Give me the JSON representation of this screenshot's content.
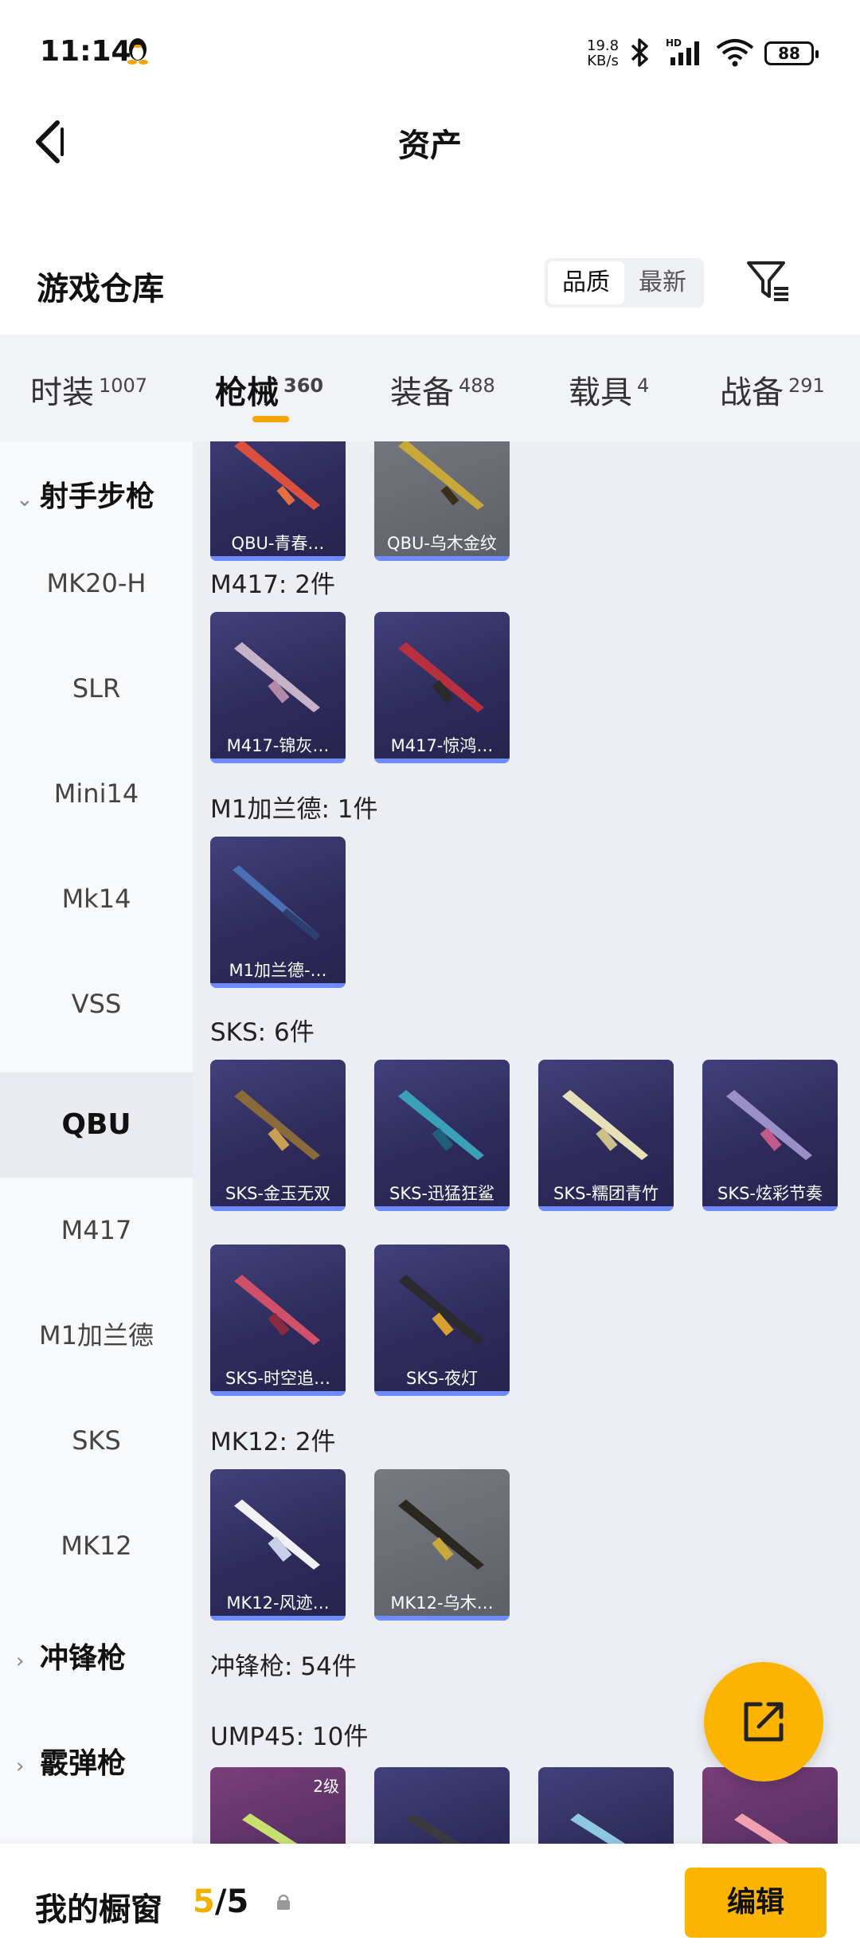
{
  "status_bar": {
    "time": "11:14",
    "net_speed_value": "19.8",
    "net_speed_unit": "KB/s",
    "battery": "88",
    "icons": [
      "qq-penguin-icon",
      "bluetooth-icon",
      "hd-signal-icon",
      "wifi-icon",
      "battery-icon"
    ]
  },
  "header": {
    "title": "资产",
    "back_icon": "chevron-left-icon"
  },
  "toolbar": {
    "heading": "游戏仓库",
    "sort_options": [
      "品质",
      "最新"
    ],
    "selected_sort": "品质",
    "filter_icon": "filter-funnel-icon"
  },
  "tabs": [
    {
      "label": "时装",
      "count": "1007"
    },
    {
      "label": "枪械",
      "count": "360",
      "active": true
    },
    {
      "label": "装备",
      "count": "488"
    },
    {
      "label": "载具",
      "count": "4"
    },
    {
      "label": "战备",
      "count": "291"
    }
  ],
  "sidebar": {
    "groups": [
      {
        "label": "射手步枪",
        "expanded": true
      },
      {
        "label": "冲锋枪",
        "expanded": false
      },
      {
        "label": "霰弹枪",
        "expanded": false
      }
    ],
    "items": [
      "MK20-H",
      "SLR",
      "Mini14",
      "Mk14",
      "VSS",
      "QBU",
      "M417",
      "M1加兰德",
      "SKS",
      "MK12"
    ],
    "selected": "QBU"
  },
  "content": {
    "qbu_cards": [
      "QBU-青春…",
      "QBU-乌木金纹"
    ],
    "sections": [
      {
        "label": "M417: 2件",
        "cards": [
          "M417-锦灰…",
          "M417-惊鸿…"
        ]
      },
      {
        "label": "M1加兰德: 1件",
        "cards": [
          "M1加兰德-…"
        ]
      },
      {
        "label": "SKS: 6件",
        "cards": [
          "SKS-金玉无双",
          "SKS-迅猛狂鲨",
          "SKS-糯团青竹",
          "SKS-炫彩节奏",
          "SKS-时空追…",
          "SKS-夜灯"
        ]
      },
      {
        "label": "MK12: 2件",
        "cards": [
          "MK12-风迹…",
          "MK12-乌木…"
        ]
      }
    ],
    "category_label": "冲锋枪: 54件",
    "ump_label": "UMP45: 10件",
    "ump_level_badge": "2级"
  },
  "fab": {
    "icon": "share-export-icon"
  },
  "bottom_bar": {
    "label": "我的橱窗",
    "count_current": "5",
    "count_sep_total": "/5",
    "lock_icon": "lock-icon",
    "edit_label": "编辑"
  },
  "colors": {
    "accent": "#FBB400",
    "card_bg": "#2E2B5C",
    "rarity_bar": "#6E8CFF"
  }
}
